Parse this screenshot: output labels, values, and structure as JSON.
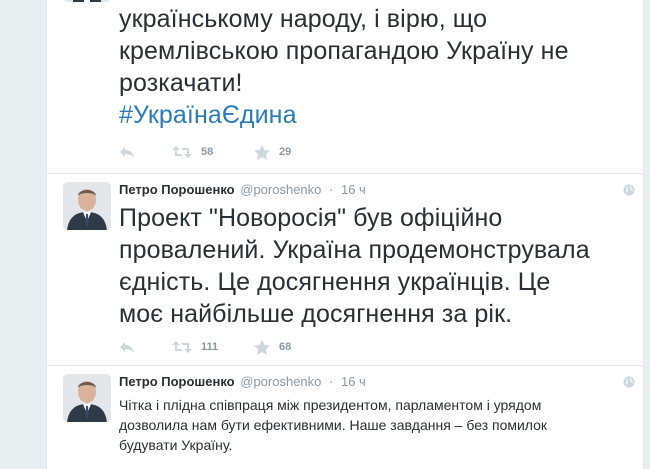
{
  "tweets": [
    {
      "lines": [
        "українському народу, і вірю, що",
        "кремлівською пропагандою Україну не",
        "розкачати!"
      ],
      "hashtag": "#УкраїнаЄдина",
      "retweets": "58",
      "favorites": "29"
    },
    {
      "name": "Петро Порошенко",
      "handle": "@poroshenko",
      "separator": "·",
      "time": "16 ч",
      "lines": [
        "Проект \"Новоросія\" був офіційно",
        "провалений. Україна продемонструвала",
        "єдність. Це досягнення українців. Це",
        "моє найбільше досягнення за рік."
      ],
      "retweets": "111",
      "favorites": "68"
    },
    {
      "name": "Петро Порошенко",
      "handle": "@poroshenko",
      "separator": "·",
      "time": "16 ч",
      "lines": [
        "Чітка і плідна співпраця між президентом, парламентом і урядом",
        "дозволила нам бути ефективними. Наше завдання – без помилок",
        "будувати Україну."
      ]
    }
  ],
  "icons": {
    "reply": "reply-icon",
    "retweet": "retweet-icon",
    "favorite": "star-icon",
    "globe": "globe-icon"
  },
  "colors": {
    "hashtag": "#2b7bb9",
    "meta": "#8899a6",
    "text": "#292f33",
    "background": "#e9eef1"
  }
}
